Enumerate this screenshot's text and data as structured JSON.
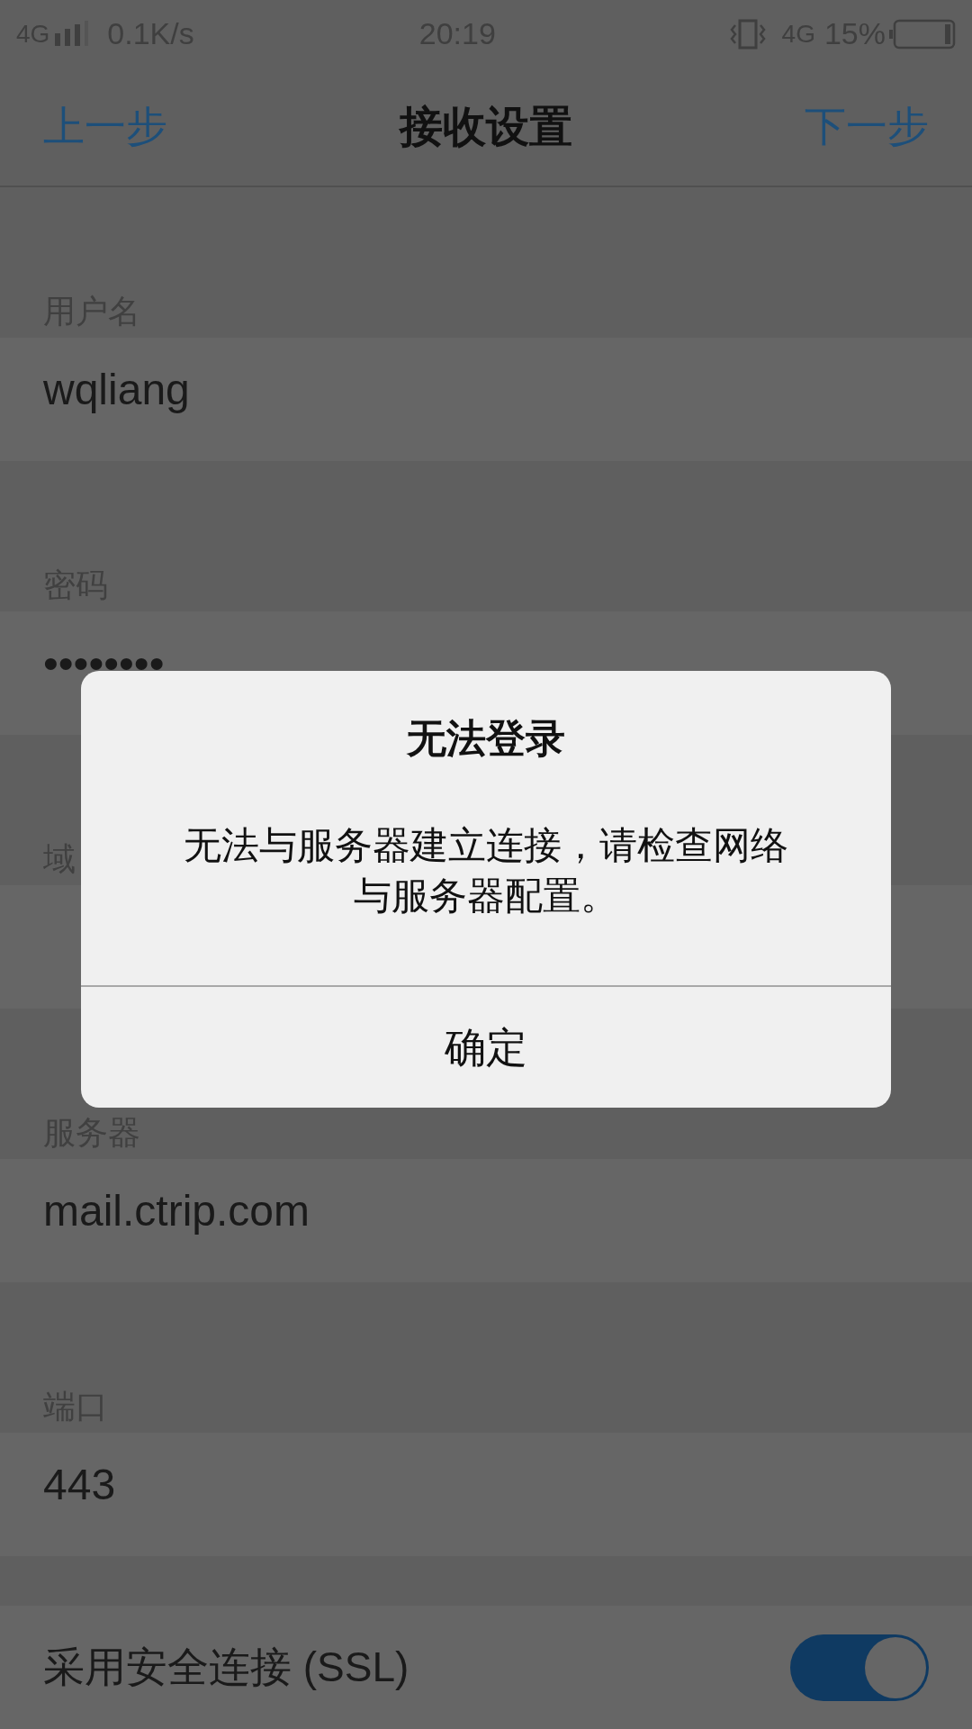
{
  "status_bar": {
    "network": "4G",
    "speed": "0.1K/s",
    "time": "20:19",
    "network_2": "4G",
    "battery": "15%"
  },
  "nav": {
    "back": "上一步",
    "title": "接收设置",
    "next": "下一步"
  },
  "fields": [
    {
      "label": "用户名",
      "value": "wqliang"
    },
    {
      "label": "密码",
      "value": "••••••••"
    },
    {
      "label": "域"
    },
    {
      "label": "服务器",
      "value": "mail.ctrip.com"
    },
    {
      "label": "端口",
      "value": "443"
    }
  ],
  "ssl": {
    "label": "采用安全连接 (SSL)",
    "on": true
  },
  "dialog": {
    "title": "无法登录",
    "message": "无法与服务器建立连接，请检查网络与服务器配置。",
    "button": "确定"
  }
}
